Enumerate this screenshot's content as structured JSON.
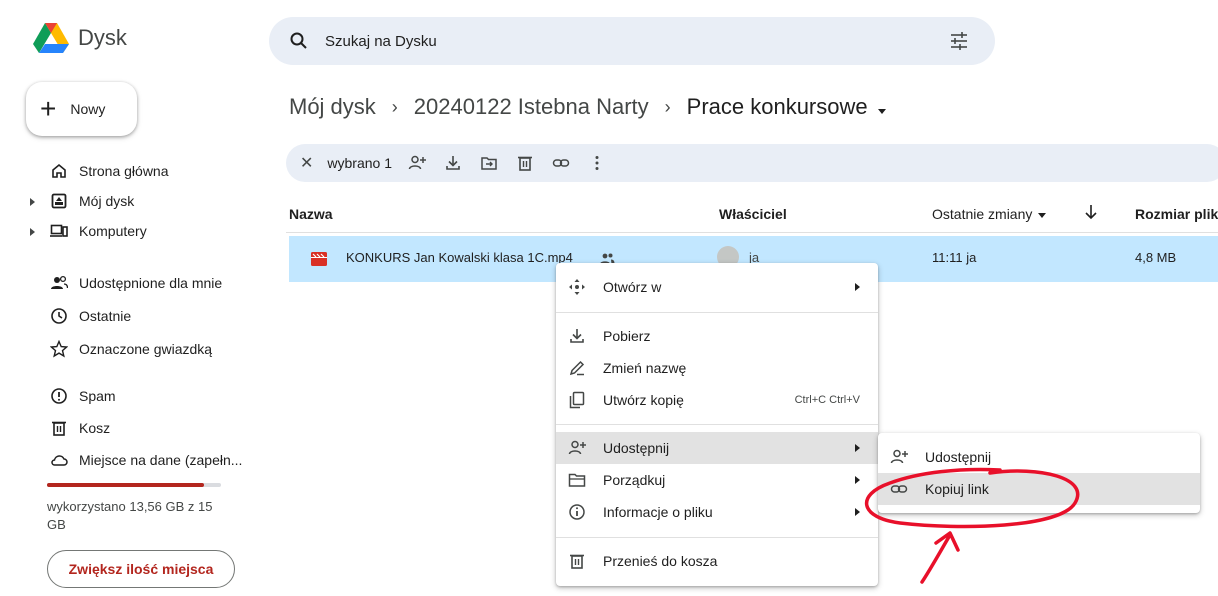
{
  "app": {
    "name": "Dysk"
  },
  "search": {
    "placeholder": "Szukaj na Dysku"
  },
  "new_button": {
    "label": "Nowy"
  },
  "sidebar": {
    "items": [
      {
        "label": "Strona główna",
        "icon": "home-icon"
      },
      {
        "label": "Mój dysk",
        "icon": "my-drive-icon"
      },
      {
        "label": "Komputery",
        "icon": "computers-icon"
      },
      {
        "label": "Udostępnione dla mnie",
        "icon": "shared-icon"
      },
      {
        "label": "Ostatnie",
        "icon": "clock-icon"
      },
      {
        "label": "Oznaczone gwiazdką",
        "icon": "star-icon"
      },
      {
        "label": "Spam",
        "icon": "spam-icon"
      },
      {
        "label": "Kosz",
        "icon": "trash-icon"
      },
      {
        "label": "Miejsce na dane (zapełn...",
        "icon": "cloud-icon"
      }
    ],
    "storage_text": "wykorzystano 13,56 GB z 15 GB",
    "storage_used_fraction": 0.904,
    "storage_color": "#b3261e",
    "more_space_label": "Zwiększ ilość miejsca"
  },
  "breadcrumb": {
    "items": [
      "Mój dysk",
      "20240122 Istebna Narty",
      "Prace konkursowe"
    ],
    "separator": "›"
  },
  "selection_toolbar": {
    "count_label": "wybrano 1"
  },
  "table": {
    "headers": {
      "name": "Nazwa",
      "owner": "Właściciel",
      "modified": "Ostatnie zmiany",
      "size": "Rozmiar plik"
    },
    "rows": [
      {
        "name": "KONKURS Jan Kowalski klasa 1C.mp4",
        "owner": "ja",
        "modified": "11:11 ja",
        "size": "4,8 MB"
      }
    ]
  },
  "context_menu": {
    "items": [
      {
        "label": "Otwórz w",
        "icon": "open-with-icon"
      },
      {
        "label": "Pobierz",
        "icon": "download-icon"
      },
      {
        "label": "Zmień nazwę",
        "icon": "rename-icon"
      },
      {
        "label": "Utwórz kopię",
        "icon": "copy-icon",
        "shortcut": "Ctrl+C Ctrl+V"
      },
      {
        "label": "Udostępnij",
        "icon": "share-icon"
      },
      {
        "label": "Porządkuj",
        "icon": "folder-icon"
      },
      {
        "label": "Informacje o pliku",
        "icon": "info-icon"
      },
      {
        "label": "Przenieś do kosza",
        "icon": "trash-icon"
      }
    ]
  },
  "share_submenu": {
    "items": [
      {
        "label": "Udostępnij",
        "icon": "share-icon"
      },
      {
        "label": "Kopiuj link",
        "icon": "link-icon"
      }
    ]
  },
  "colors": {
    "selected_row": "#c2e7ff",
    "search_bg": "#e9eef6",
    "annotation": "#e8102a"
  }
}
